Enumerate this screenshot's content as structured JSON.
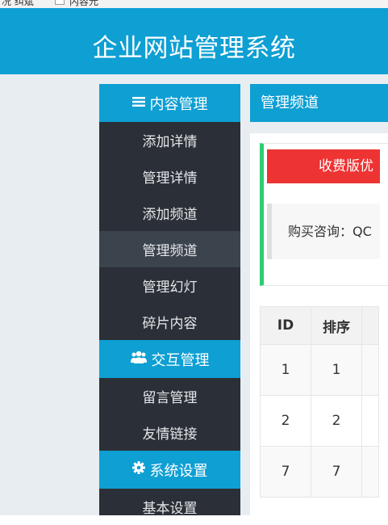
{
  "top": {
    "partial_text_1": "况 纠斌",
    "partial_text_2": "内容元"
  },
  "header": {
    "title": "企业网站管理系统"
  },
  "sidebar": {
    "content_group": "内容管理",
    "content_items": [
      "添加详情",
      "管理详情",
      "添加频道",
      "管理频道",
      "管理幻灯",
      "碎片内容"
    ],
    "interact_group": "交互管理",
    "interact_items": [
      "留言管理",
      "友情链接"
    ],
    "system_group": "系统设置",
    "system_items": [
      "基本设置"
    ]
  },
  "breadcrumb": {
    "current": "管理频道"
  },
  "notice": {
    "promo": "收费版优",
    "contact": "购买咨询：QC"
  },
  "table": {
    "headers": [
      "ID",
      "排序"
    ],
    "rows": [
      [
        "1",
        "1"
      ],
      [
        "2",
        "2"
      ],
      [
        "7",
        "7"
      ]
    ]
  },
  "colors": {
    "accent": "#0e9fd3",
    "sidebar_bg": "#2b3038",
    "promo": "#ee3333",
    "notice_border": "#2ecc71"
  }
}
